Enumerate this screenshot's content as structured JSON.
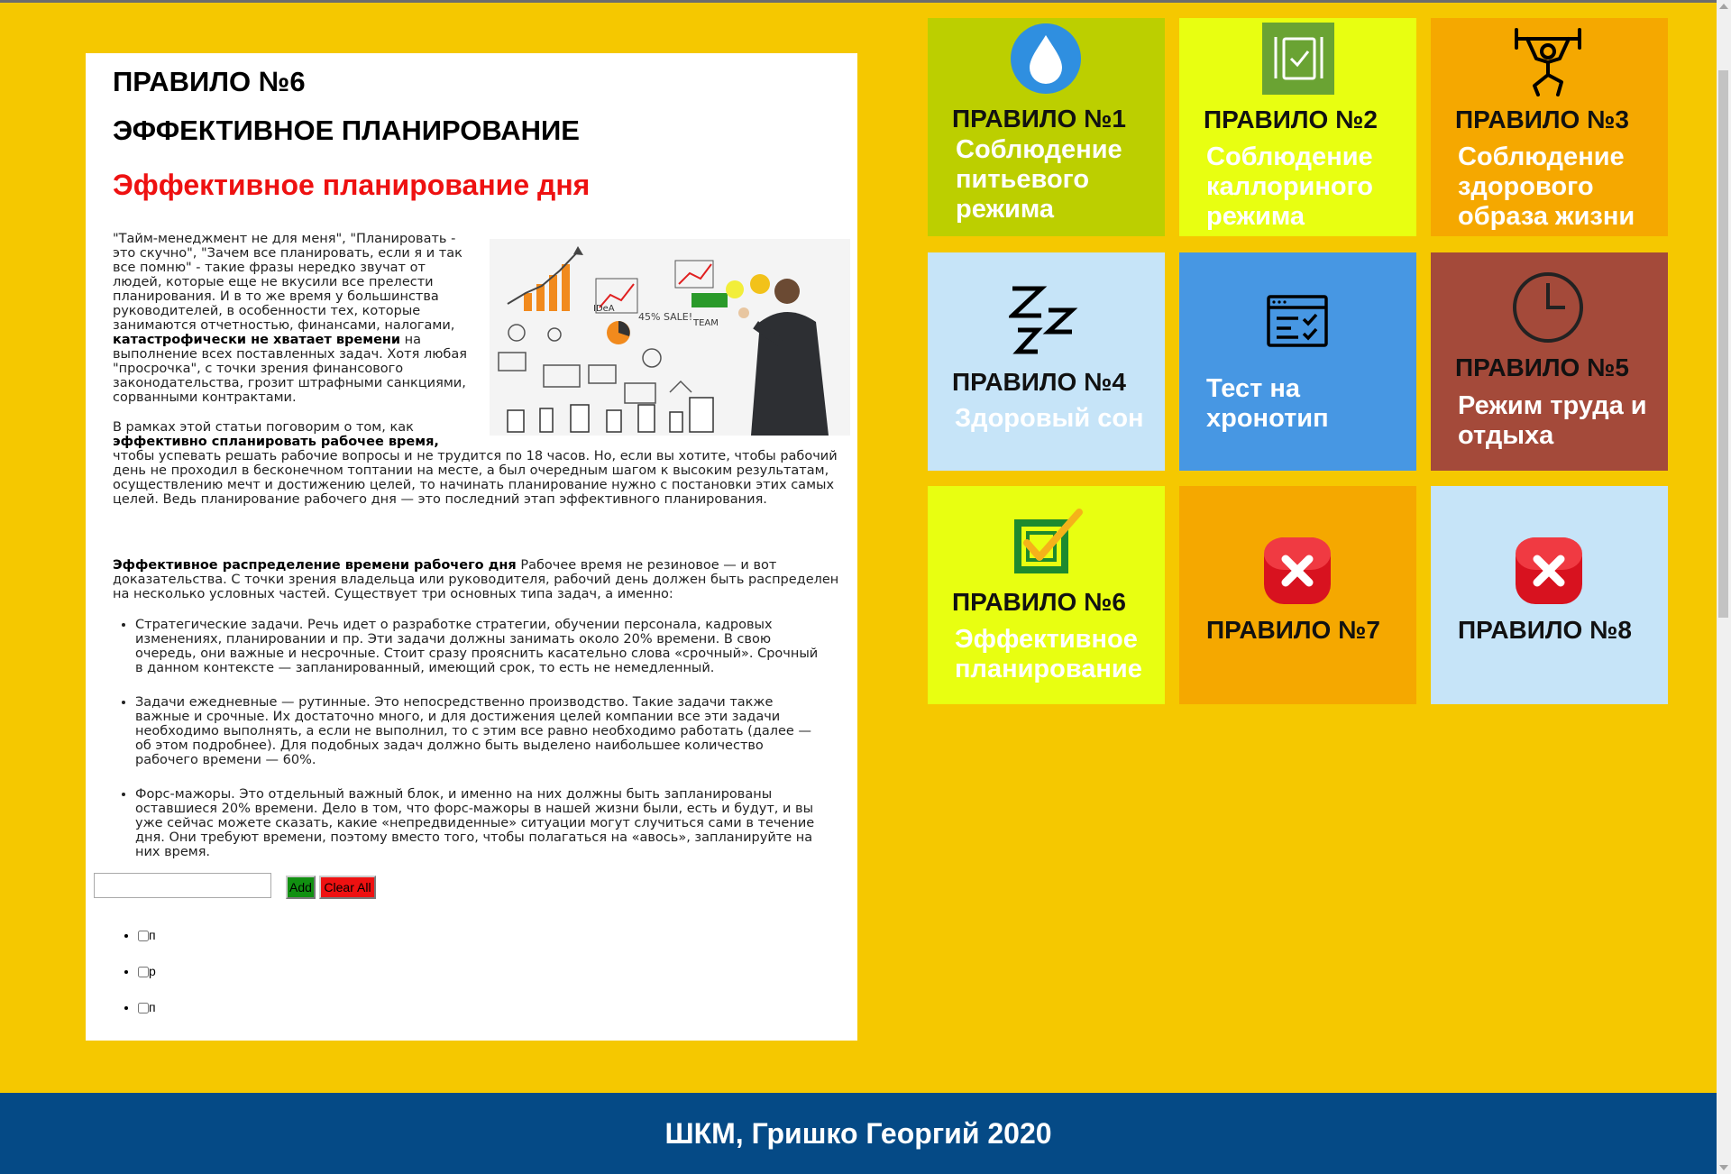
{
  "article": {
    "rule_title": "ПРАВИЛО №6",
    "plan_title": "ЭФФЕКТИВНОЕ ПЛАНИРОВАНИЕ",
    "red_title": "Эффективное планирование дня",
    "intro_a": "\"Тайм-менеджмент не для меня\", \"Планировать - это скучно\", \"Зачем все планировать, если я и так все помню\" - такие фразы нередко звучат от людей, которые еще не вкусили все прелести планирования. И в то же время у большинства руководителей, в особенности тех, которые занимаются отчетностью, финансами, налогами, ",
    "intro_bold": "катастрофически не хватает времени",
    "intro_b": " на выполнение всех поставленных задач. Хотя любая \"просрочка\", с точки зрения финансового законодательства, грозит штрафными санкциями, сорванными контрактами.",
    "p2_a": "В рамках этой статьи поговорим о том, как ",
    "p2_bold": "эффективно спланировать рабочее время,",
    "p2_b": " чтобы успевать решать рабочие вопросы и не трудится по 18 часов. Но, если вы хотите, чтобы рабочий день не проходил в бесконечном топтании на месте, а был очередным шагом к высоким результатам, осуществлению мечт и достижению целей, то начинать планирование нужно с постановки этих самых целей. Ведь планирование рабочего дня — это последний этап эффективного планирования.",
    "p3_bold": "Эффективное распределение времени рабочего дня",
    "p3_rest": " Рабочее время не резиновое — и вот доказательства. С точки зрения владельца или руководителя, рабочий день должен быть распределен на несколько условных частей. Существует три основных типа задач, а именно:",
    "bullets": [
      "Стратегические задачи. Речь идет о разработке стратегии, обучении персонала, кадровых изменениях, планировании и пр. Эти задачи должны занимать около 20% времени. В свою очередь, они важные и несрочные. Стоит сразу прояснить касательно слова «срочный». Срочный в данном контексте — запланированный, имеющий срок, то есть не немедленный.",
      "Задачи ежедневные — рутинные. Это непосредственно производство. Такие задачи также важные и срочные. Их достаточно много, и для достижения целей компании все эти задачи необходимо выполнять, а если не выполнил, то с этим все равно необходимо работать (далее — об этом подробнее). Для подобных задач должно быть выделено наибольшее количество рабочего времени — 60%.",
      "Форс-мажоры. Это отдельный важный блок, и именно на них должны быть запланированы оставшиеся 20% времени. Дело в том, что форс-мажоры в нашей жизни были, есть и будут, и вы уже сейчас можете сказать, какие «непредвиденные» ситуации могут случиться сами в течение дня. Они требуют времени, поэтому вместо того, чтобы полагаться на «авось», запланируйте на них время."
    ]
  },
  "photo_labels": [
    "IDeA",
    "TEAM"
  ],
  "todo": {
    "input_value": "",
    "add_label": "Add",
    "clear_label": "Clear All",
    "items": [
      "п",
      "р",
      "п"
    ]
  },
  "tiles": [
    {
      "title": "ПРАВИЛО №1",
      "subtitle": "Соблюдение питьевого режима",
      "bg": "#bccf00",
      "icon": "water-drop-icon"
    },
    {
      "title": "ПРАВИЛО №2",
      "subtitle": "Соблюдение каллориного режима",
      "bg": "#e8ff11",
      "icon": "meal-plan-icon"
    },
    {
      "title": "ПРАВИЛО №3",
      "subtitle": "Соблюдение здорового образа жизни",
      "bg": "#f5a800",
      "icon": "weightlifter-icon"
    },
    {
      "title": "ПРАВИЛО №4",
      "subtitle": "Здоровый сон",
      "bg": "#c6e4f8",
      "icon": "sleep-zzz-icon"
    },
    {
      "title": "",
      "subtitle": "Тест на хронотип",
      "bg": "#4797e3",
      "icon": "checklist-window-icon"
    },
    {
      "title": "ПРАВИЛО №5",
      "subtitle": "Режим труда и отдыха",
      "bg": "#a44a3a",
      "icon": "clock-icon"
    },
    {
      "title": "ПРАВИЛО №6",
      "subtitle": "Эффективное планирование",
      "bg": "#e8ff11",
      "icon": "checked-box-icon"
    },
    {
      "title": "ПРАВИЛО №7",
      "subtitle": "",
      "bg": "#f5a800",
      "icon": "close-icon"
    },
    {
      "title": "ПРАВИЛО №8",
      "subtitle": "",
      "bg": "#c6e4f8",
      "icon": "close-icon"
    }
  ],
  "footer": {
    "text": "ШКМ, Гришко Георгий 2020"
  },
  "colors": {
    "page_bg": "#f5c800",
    "footer_bg": "#054a86",
    "red_title": "#ee1111",
    "add_btn": "#119011",
    "clear_btn": "#ee1111"
  }
}
